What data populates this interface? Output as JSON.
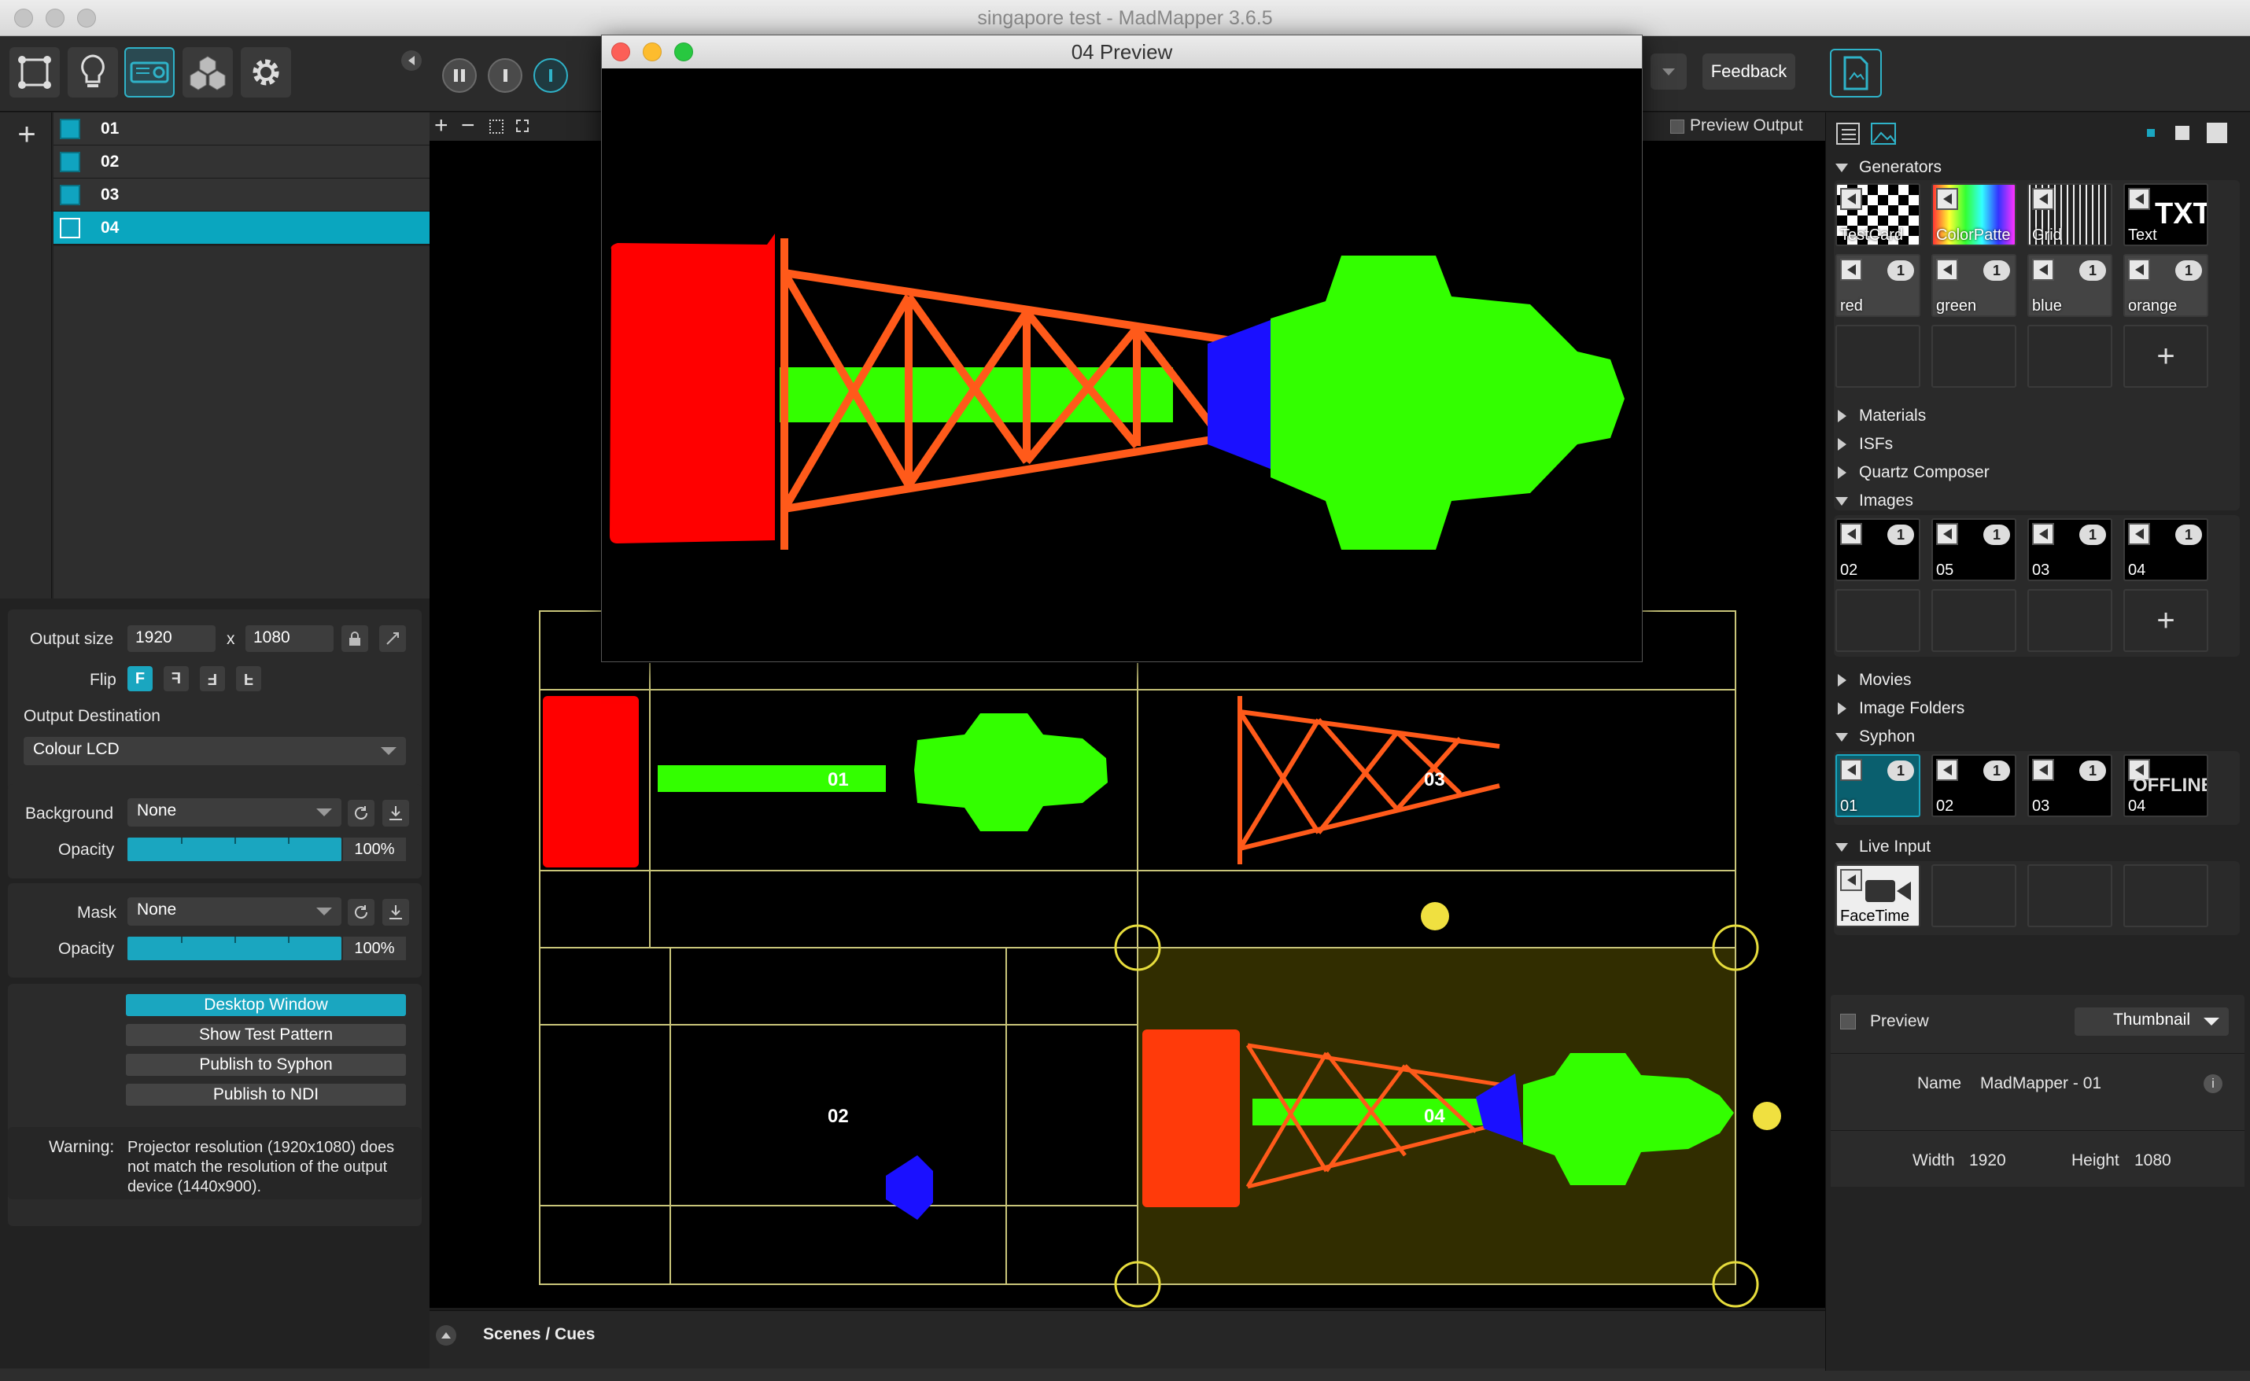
{
  "app": {
    "title": "singapore test - MadMapper 3.6.5"
  },
  "toolbar": {
    "feedback": "Feedback"
  },
  "surfaces": [
    {
      "label": "01",
      "selected": false
    },
    {
      "label": "02",
      "selected": false
    },
    {
      "label": "03",
      "selected": false
    },
    {
      "label": "04",
      "selected": true
    }
  ],
  "output": {
    "size_label": "Output size",
    "width": "1920",
    "x_sep": "x",
    "height": "1080",
    "flip_label": "Flip",
    "flip_options": [
      "F",
      "F",
      "F",
      "F"
    ],
    "destination_label": "Output Destination",
    "destination": "Colour LCD"
  },
  "background": {
    "label": "Background",
    "value": "None",
    "opacity_label": "Opacity",
    "opacity": "100%"
  },
  "mask": {
    "label": "Mask",
    "value": "None",
    "opacity_label": "Opacity",
    "opacity": "100%"
  },
  "actions": {
    "desktop_window": "Desktop Window",
    "show_test_pattern": "Show Test Pattern",
    "publish_syphon": "Publish to Syphon",
    "publish_ndi": "Publish to NDI"
  },
  "warning": {
    "label": "Warning:",
    "text": "Projector resolution (1920x1080) does not match the resolution of the output device (1440x900)."
  },
  "canvas": {
    "preview_output": "Preview Output",
    "labels": [
      "01",
      "03",
      "02",
      "04"
    ]
  },
  "preview_window": {
    "title": "04 Preview"
  },
  "scenes": {
    "label": "Scenes / Cues"
  },
  "library": {
    "generators_title": "Generators",
    "generators": [
      "TestCard",
      "ColorPatte",
      "Grid",
      "Text",
      "red",
      "green",
      "blue",
      "orange"
    ],
    "materials": "Materials",
    "isfs": "ISFs",
    "quartz": "Quartz Composer",
    "images_title": "Images",
    "images": [
      "02",
      "05",
      "03",
      "04"
    ],
    "movies": "Movies",
    "image_folders": "Image Folders",
    "syphon_title": "Syphon",
    "syphon": [
      "01",
      "02",
      "03",
      "04"
    ],
    "syphon_offline": "OFFLINE",
    "live_input_title": "Live Input",
    "live_input": [
      "FaceTime"
    ],
    "badge": "1",
    "txt_glyph": "TXT"
  },
  "preview_panel": {
    "label": "Preview",
    "mode": "Thumbnail",
    "name_label": "Name",
    "name": "MadMapper - 01",
    "width_label": "Width",
    "width": "1920",
    "height_label": "Height",
    "height": "1080"
  },
  "colors": {
    "accent": "#1aa6c0",
    "red": "#ff0000",
    "green": "#33ff00",
    "blue": "#1a10ff",
    "orange": "#ff5a1a",
    "guide": "#d7d36a"
  }
}
